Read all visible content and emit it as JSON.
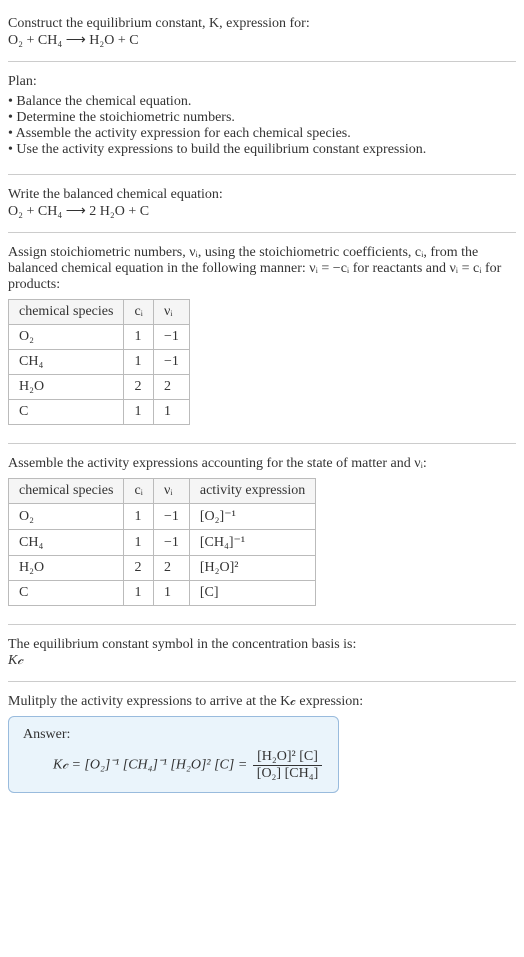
{
  "intro": {
    "prompt": "Construct the equilibrium constant, K, expression for:",
    "equation": "O₂ + CH₄ ⟶ H₂O + C"
  },
  "plan": {
    "heading": "Plan:",
    "items": [
      "Balance the chemical equation.",
      "Determine the stoichiometric numbers.",
      "Assemble the activity expression for each chemical species.",
      "Use the activity expressions to build the equilibrium constant expression."
    ]
  },
  "balanced": {
    "heading": "Write the balanced chemical equation:",
    "equation": "O₂ + CH₄ ⟶ 2 H₂O + C"
  },
  "stoich": {
    "heading_part1": "Assign stoichiometric numbers, νᵢ, using the stoichiometric coefficients, cᵢ, from the balanced chemical equation in the following manner: νᵢ = −cᵢ for reactants and νᵢ = cᵢ for products:",
    "headers": [
      "chemical species",
      "cᵢ",
      "νᵢ"
    ],
    "rows": [
      {
        "species": "O₂",
        "c": "1",
        "v": "−1"
      },
      {
        "species": "CH₄",
        "c": "1",
        "v": "−1"
      },
      {
        "species": "H₂O",
        "c": "2",
        "v": "2"
      },
      {
        "species": "C",
        "c": "1",
        "v": "1"
      }
    ]
  },
  "activity": {
    "heading": "Assemble the activity expressions accounting for the state of matter and νᵢ:",
    "headers": [
      "chemical species",
      "cᵢ",
      "νᵢ",
      "activity expression"
    ],
    "rows": [
      {
        "species": "O₂",
        "c": "1",
        "v": "−1",
        "act": "[O₂]⁻¹"
      },
      {
        "species": "CH₄",
        "c": "1",
        "v": "−1",
        "act": "[CH₄]⁻¹"
      },
      {
        "species": "H₂O",
        "c": "2",
        "v": "2",
        "act": "[H₂O]²"
      },
      {
        "species": "C",
        "c": "1",
        "v": "1",
        "act": "[C]"
      }
    ]
  },
  "symbol": {
    "line1": "The equilibrium constant symbol in the concentration basis is:",
    "line2": "K𝒸"
  },
  "multiply": {
    "heading": "Mulitply the activity expressions to arrive at the K𝒸 expression:"
  },
  "answer": {
    "label": "Answer:",
    "lhs": "K𝒸 = [O₂]⁻¹ [CH₄]⁻¹ [H₂O]² [C] =",
    "num": "[H₂O]² [C]",
    "den": "[O₂] [CH₄]"
  }
}
